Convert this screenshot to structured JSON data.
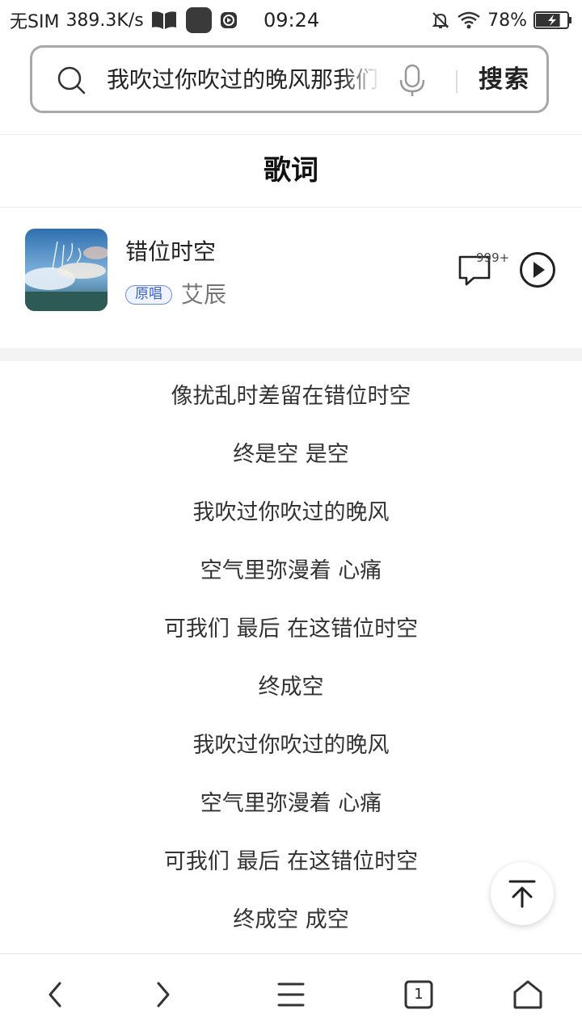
{
  "status_bar": {
    "sim": "无SIM",
    "net_speed": "389.3K/s",
    "time": "09:24",
    "battery_pct": "78%",
    "battery_level": 0.78,
    "icons": [
      "book-icon",
      "app-icon",
      "record-icon",
      "mute-icon",
      "wifi-icon",
      "battery-icon"
    ]
  },
  "search": {
    "query": "我吹过你吹过的晚风那我们",
    "button_label": "搜索"
  },
  "section_title": "歌词",
  "song": {
    "title": "错位时空",
    "badge": "原唱",
    "artist": "艾辰",
    "comment_count": "999+"
  },
  "lyrics": [
    "像扰乱时差留在错位时空",
    "终是空 是空",
    "我吹过你吹过的晚风",
    "空气里弥漫着 心痛",
    "可我们 最后 在这错位时空",
    "终成空",
    "我吹过你吹过的晚风",
    "空气里弥漫着 心痛",
    "可我们 最后 在这错位时空",
    "终成空 成空"
  ],
  "bottom_nav": {
    "tab_count": "1",
    "items": [
      "back-icon",
      "forward-icon",
      "menu-icon",
      "tabs-icon",
      "home-icon"
    ]
  },
  "colors": {
    "badge_border": "#6f8fd6",
    "badge_text": "#3b63c4",
    "text_primary": "#222222",
    "text_secondary": "#777777"
  }
}
